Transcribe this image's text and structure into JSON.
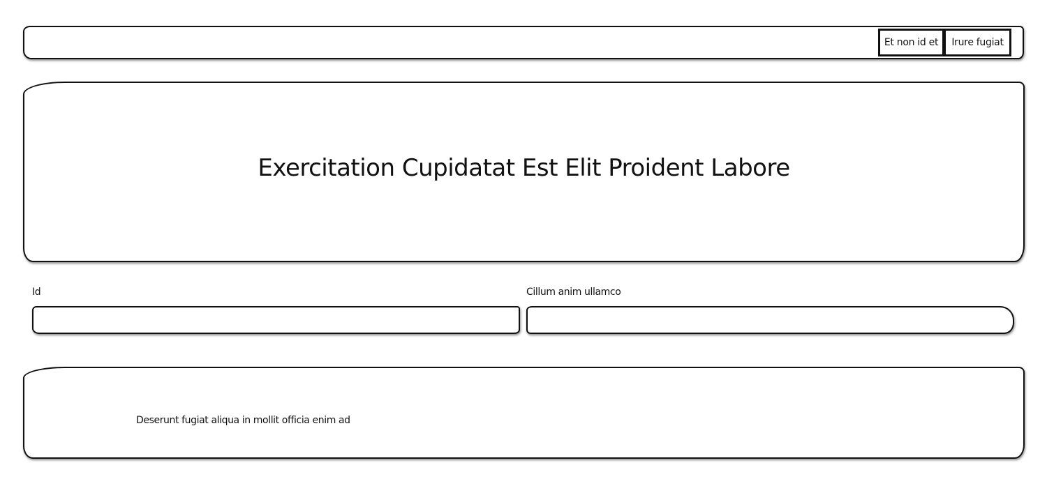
{
  "navbar": {
    "buttons": [
      {
        "label": "Et non id et"
      },
      {
        "label": "Irure fugiat"
      }
    ]
  },
  "hero": {
    "title": "Exercitation Cupidatat Est Elit Proident Labore"
  },
  "form": {
    "fields": [
      {
        "label": "Id",
        "value": "",
        "placeholder": ""
      },
      {
        "label": "Cillum anim ullamco",
        "value": "",
        "placeholder": ""
      }
    ]
  },
  "footer": {
    "text": "Deserunt fugiat aliqua in mollit officia enim ad"
  }
}
